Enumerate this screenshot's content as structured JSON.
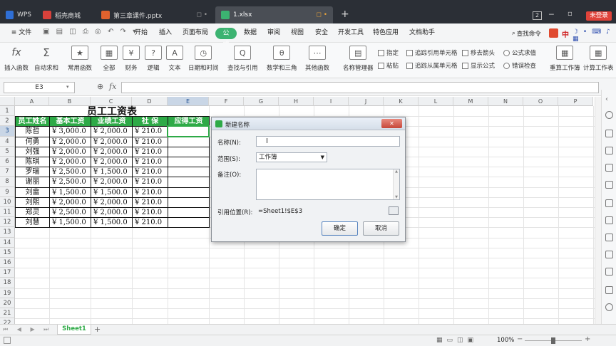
{
  "titlebar": {
    "tabs": [
      {
        "label": "WPS",
        "color": "#2f6fd6"
      },
      {
        "label": "稻壳商城",
        "color": "#d9413b"
      },
      {
        "label": "第三章课件.pptx",
        "color": "#e0622e"
      },
      {
        "label": "1.xlsx",
        "color": "#3cb371"
      }
    ],
    "add_tab": "+",
    "window_count": "2",
    "login_label": "未登录"
  },
  "menubar": {
    "file": "≡ 文件",
    "items": [
      "开始",
      "插入",
      "页面布局",
      "公式",
      "数据",
      "审阅",
      "视图",
      "安全",
      "开发工具",
      "特色应用",
      "文档助手"
    ],
    "active": "公式",
    "search": "查找命令",
    "lang_badge": "中"
  },
  "ribbon": {
    "big": [
      {
        "label": "插入函数",
        "icon": "fx"
      },
      {
        "label": "自动求和",
        "icon": "Σ"
      },
      {
        "label": "常用函数",
        "icon": "★"
      },
      {
        "label": "全部",
        "icon": "▦"
      },
      {
        "label": "财务",
        "icon": "¥"
      },
      {
        "label": "逻辑",
        "icon": "?"
      },
      {
        "label": "文本",
        "icon": "A"
      },
      {
        "label": "日期和时间",
        "icon": "◷"
      },
      {
        "label": "查找与引用",
        "icon": "Q"
      },
      {
        "label": "数学和三角",
        "icon": "θ"
      },
      {
        "label": "其他函数",
        "icon": "⋯"
      },
      {
        "label": "名称管理器",
        "icon": "▤"
      },
      {
        "label": "重算工作簿",
        "icon": "▦"
      },
      {
        "label": "计算工作表",
        "icon": "▦"
      }
    ],
    "small": [
      "指定",
      "粘贴",
      "追踪引用单元格",
      "追踪从属单元格",
      "移去箭头",
      "显示公式",
      "公式求值",
      "错误检查"
    ]
  },
  "formulabar": {
    "cell_ref": "E3",
    "fx_label": "fx",
    "zoom_icon": "⊕"
  },
  "columns": [
    "A",
    "B",
    "C",
    "D",
    "E",
    "F",
    "G",
    "H",
    "I",
    "J",
    "K",
    "L",
    "M",
    "N",
    "O",
    "P"
  ],
  "rows": [
    "1",
    "2",
    "3",
    "4",
    "5",
    "6",
    "7",
    "8",
    "9",
    "10",
    "11",
    "12",
    "13",
    "14",
    "15",
    "16",
    "17",
    "18",
    "19",
    "20",
    "21",
    "22"
  ],
  "sheet": {
    "title": "员工工资表",
    "headers": [
      "员工姓名",
      "基本工资",
      "业绩工资",
      "社 保",
      "应得工资"
    ],
    "data": [
      [
        "陈哲",
        "¥  3,000.0",
        "¥  2,000.0",
        "¥  210.0"
      ],
      [
        "何勇",
        "¥  2,000.0",
        "¥  2,000.0",
        "¥  210.0"
      ],
      [
        "刘强",
        "¥  2,000.0",
        "¥  2,000.0",
        "¥  210.0"
      ],
      [
        "陈琪",
        "¥  2,000.0",
        "¥  2,000.0",
        "¥  210.0"
      ],
      [
        "罗瑞",
        "¥  2,500.0",
        "¥  1,500.0",
        "¥  210.0"
      ],
      [
        "谢丽",
        "¥  2,500.0",
        "¥  2,000.0",
        "¥  210.0"
      ],
      [
        "刘畲",
        "¥  1,500.0",
        "¥  1,500.0",
        "¥  210.0"
      ],
      [
        "刘熙",
        "¥  2,000.0",
        "¥  2,000.0",
        "¥  210.0"
      ],
      [
        "郑灵",
        "¥  2,500.0",
        "¥  2,000.0",
        "¥  210.0"
      ],
      [
        "刘慧",
        "¥  1,500.0",
        "¥  1,500.0",
        "¥  210.0"
      ]
    ]
  },
  "dialog": {
    "title": "新建名称",
    "name_label": "名称(N):",
    "name_value": "",
    "scope_label": "范围(S):",
    "scope_value": "工作簿",
    "comment_label": "备注(O):",
    "ref_label": "引用位置(R):",
    "ref_value": "=Sheet1!$E$3",
    "ok": "确定",
    "cancel": "取消",
    "close": "✕"
  },
  "sheettabs": {
    "active": "Sheet1",
    "add": "+"
  },
  "status": {
    "zoom": "100%",
    "minus": "−",
    "plus": "+"
  }
}
